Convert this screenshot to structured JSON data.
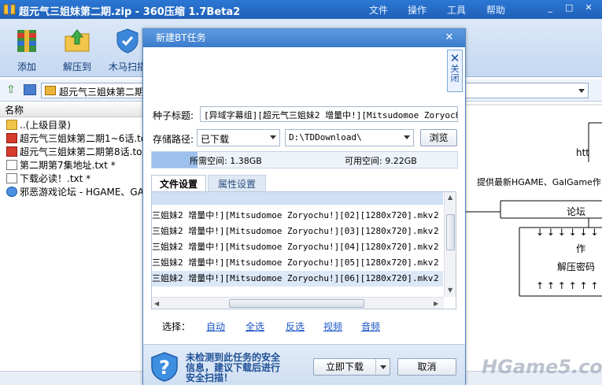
{
  "app": {
    "title": "超元气三姐妹第二期.zip - 360压缩 1.7Beta2",
    "menu": [
      "文件",
      "操作",
      "工具",
      "帮助"
    ],
    "toolbar": {
      "add": "添加",
      "extract": "解压到",
      "scan": "木马扫描"
    },
    "address": "超元气三姐妹第二期",
    "column_name": "名称",
    "files": [
      {
        "name": "..(上级目录)",
        "icon": "folder-up-icon"
      },
      {
        "name": "超元气三姐妹第二期1~6话.torrent",
        "icon": "torrent-icon"
      },
      {
        "name": "超元气三姐妹第二期第8话.torrent",
        "icon": "torrent-icon"
      },
      {
        "name": "第二期第7集地址.txt *",
        "icon": "text-file-icon"
      },
      {
        "name": "下载必读！.txt *",
        "icon": "text-file-icon"
      },
      {
        "name": "邪恶游戏论坛 - HGAME、GALGAME",
        "icon": "web-link-icon"
      }
    ],
    "preview": {
      "line1": "htt",
      "line2": "提供最新HGAME、GalGame作",
      "line3": "论坛",
      "line4": "作",
      "line5": "解压密码"
    },
    "watermark": "HGame5.com"
  },
  "dialog": {
    "title": "新建BT任务",
    "side_close": "关闭",
    "torrent_label": "种子标题:",
    "torrent_value": "[异域字幕组][超元气三姐妹2 增量中!][Mitsudomoe Zoryochu!]",
    "path_label": "存储路径:",
    "path_category": "已下载",
    "path_value": "D:\\TDDownload\\",
    "browse": "浏览",
    "required_space": "所需空间: 1.38GB",
    "available_space": "可用空间: 9.22GB",
    "space_used_fraction": 0.15,
    "tabs": [
      "文件设置",
      "属性设置"
    ],
    "files": [
      {
        "name": "三姐妹2 增量中!][Mitsudomoe Zoryochu!][02][1280x720].mkv",
        "num": "2",
        "selected": false
      },
      {
        "name": "三姐妹2 增量中!][Mitsudomoe Zoryochu!][03][1280x720].mkv",
        "num": "2",
        "selected": false
      },
      {
        "name": "三姐妹2 增量中!][Mitsudomoe Zoryochu!][04][1280x720].mkv",
        "num": "2",
        "selected": false
      },
      {
        "name": "三姐妹2 增量中!][Mitsudomoe Zoryochu!][05][1280x720].mkv",
        "num": "2",
        "selected": false
      },
      {
        "name": "三姐妹2 增量中!][Mitsudomoe Zoryochu!][06][1280x720].mkv",
        "num": "2",
        "selected": true
      }
    ],
    "select_label": "选择：",
    "select_links": [
      "自动",
      "全选",
      "反选",
      "视频",
      "音频"
    ],
    "warning": "未检测到此任务的安全信息，建议下载后进行安全扫描！",
    "download_now": "立即下载",
    "cancel": "取消"
  }
}
